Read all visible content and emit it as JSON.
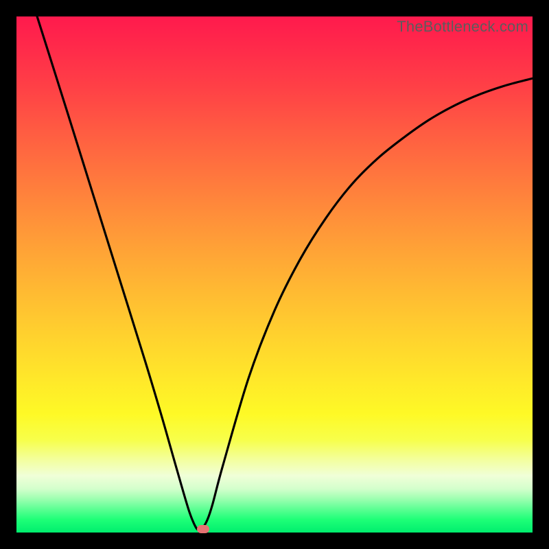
{
  "watermark": "TheBottleneck.com",
  "colors": {
    "frame": "#000000",
    "curve": "#000000",
    "marker": "#e57373",
    "gradient_top": "#ff1a4d",
    "gradient_bottom": "#00ee6e"
  },
  "chart_data": {
    "type": "line",
    "title": "",
    "xlabel": "",
    "ylabel": "",
    "xlim": [
      0,
      100
    ],
    "ylim": [
      0,
      100
    ],
    "x": [
      4,
      10,
      15,
      20,
      25,
      28,
      30,
      32,
      33.5,
      34.5,
      35.2,
      36,
      37,
      38,
      40,
      45,
      50,
      55,
      60,
      65,
      70,
      75,
      80,
      85,
      90,
      95,
      100
    ],
    "values": [
      100,
      81,
      65,
      49,
      33,
      23,
      16,
      9,
      4,
      1.5,
      0.5,
      0.8,
      2.5,
      5.5,
      13,
      30,
      43,
      53,
      61,
      67.5,
      72.5,
      76.5,
      80,
      82.8,
      85,
      86.7,
      88
    ],
    "marker": {
      "x": 36.2,
      "y": 0.6
    },
    "notes": "Bottleneck-style V curve over vertical red-to-green gradient; no axis ticks or labels visible."
  }
}
